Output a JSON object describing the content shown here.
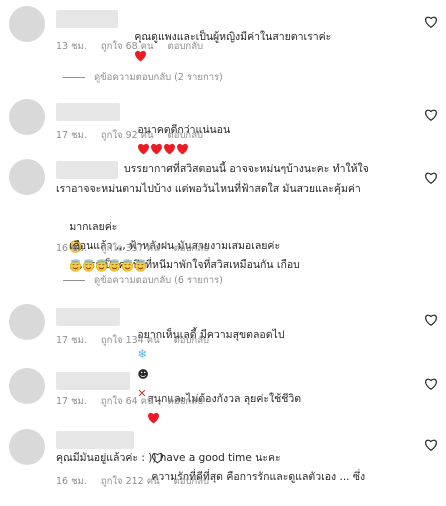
{
  "comments": [
    {
      "text": "คุณดูแพงและเป็นผู้หญิงมีค่าในสายตาเราค่ะ",
      "emoji_after": "heart",
      "time": "13 ชม.",
      "likes": "ถูกใจ 68 คน",
      "reply": "ตอบกลับ"
    },
    {
      "text": "อนาคตดีกว่าแน่นอน",
      "emoji_after": "4 hearts",
      "time": "17 ชม.",
      "likes": "ถูกใจ 92 คน",
      "reply": "ตอบกลับ"
    },
    {
      "text_line1": "บรรยากาศที่สวิสตอนนี้ อาจจะหม่นๆบ้างนะคะ ทำให้ใจ",
      "text_line2": "เราอาจจะหม่นตามไปบ้าง แต่พอวันไหนที่ฟ้าสดใส มันสวยและคุ้มค่า",
      "text_line3a": "มากเลยค่ะ",
      "text_line3b": ",,,, เราเป็นคนนึงที่หนีมาพักใจที่สวิสเหมือนกัน เกือบ",
      "text_line4": "เดือนแล้ว ,,, ฟ้าหลังฝน มันสวยงามเสมอเลยค่ะ",
      "time": "16 ชม.",
      "likes": "ถูกใจ 357 คน",
      "reply": "ตอบกลับ"
    },
    {
      "text": "อยากเห็นเลดี้ มีความสุขตลอดไป",
      "time": "17 ชม.",
      "likes": "ถูกใจ 134 คน",
      "reply": "ตอบกลับ"
    },
    {
      "text": "สนุกและไม่ต้องกังวล ลุยค่ะใช้ชีวิต",
      "time": "17 ชม.",
      "likes": "ถูกใจ 64 คน",
      "reply": "ตอบกลับ"
    },
    {
      "text_line1": "ความรักที่ดีที่สุด คือการรักและดูแลตัวเอง ... ซึ่ง",
      "text_line2": "คุณมีมันอยู่แล้วค่ะ : )) have a good time นะคะ",
      "time": "16 ชม.",
      "likes": "ถูกใจ 212 คน",
      "reply": "ตอบกลับ"
    }
  ],
  "view_replies": [
    "ดูข้อความตอบกลับ (2 รายการ)",
    "ดูข้อความตอบกลับ (6 รายการ)"
  ],
  "icons": {
    "like": "heart-outline-icon",
    "emoji_heart": "red-heart",
    "emoji_smile": "smiling-face-with-halo"
  },
  "colors": {
    "meta": "#8e8e8e",
    "heart": "#ed1c24",
    "placeholder": "#e6e6e6"
  }
}
